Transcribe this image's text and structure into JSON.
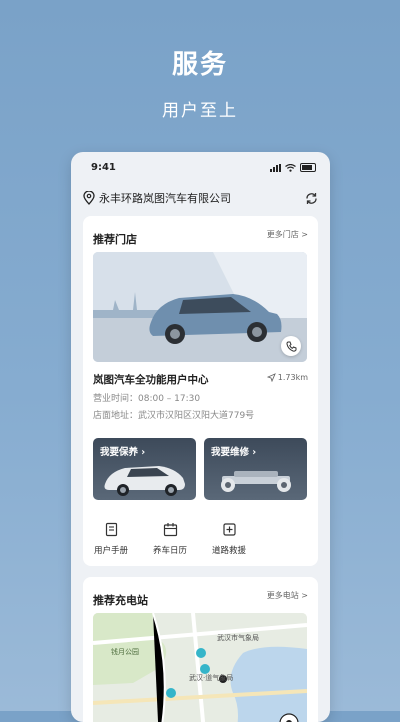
{
  "hero": {
    "title": "服务",
    "subtitle": "用户至上"
  },
  "status_bar": {
    "time": "9:41"
  },
  "location": {
    "address": "永丰环路岚图汽车有限公司"
  },
  "store_section": {
    "title": "推荐门店",
    "more": "更多门店 >",
    "store_name": "岚图汽车全功能用户中心",
    "distance": "1.73km",
    "hours": "营业时间：08:00 – 17:30",
    "address": "店面地址：武汉市汉阳区汉阳大道779号",
    "services": [
      {
        "label": "我要保养 ›"
      },
      {
        "label": "我要维修 ›"
      }
    ],
    "shortcuts": [
      {
        "label": "用户手册",
        "icon": "manual-icon"
      },
      {
        "label": "养车日历",
        "icon": "calendar-icon"
      },
      {
        "label": "道路救援",
        "icon": "roadside-icon"
      }
    ]
  },
  "charge_section": {
    "title": "推荐充电站",
    "more": "更多电站 >",
    "map_labels": {
      "park": "钱月公园",
      "bureau1": "武汉市气象局",
      "bureau2": "武汉·道气象局"
    }
  }
}
